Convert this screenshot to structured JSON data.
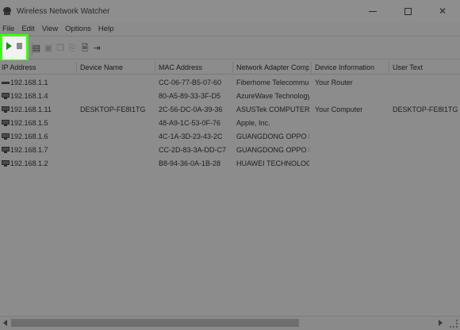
{
  "window": {
    "title": "Wireless Network Watcher",
    "icon": "app-icon"
  },
  "menu": [
    "File",
    "Edit",
    "View",
    "Options",
    "Help"
  ],
  "toolbar": {
    "icons": [
      "play-icon",
      "stop-icon",
      "table-icon",
      "save-icon",
      "copy-icon",
      "export-icon",
      "properties-icon",
      "exit-icon"
    ]
  },
  "table": {
    "columns": [
      "IP Address",
      "Device Name",
      "MAC Address",
      "Network Adapter Comp...",
      "Device Information",
      "User Text"
    ],
    "rows": [
      {
        "ip": "192.168.1.1",
        "name": "",
        "mac": "CC-06-77-B5-07-60",
        "company": "Fiberhome Telecommu...",
        "info": "Your Router",
        "user": ""
      },
      {
        "ip": "192.168.1.4",
        "name": "",
        "mac": "80-A5-89-33-3F-D5",
        "company": "AzureWave Technology ...",
        "info": "",
        "user": ""
      },
      {
        "ip": "192.168.1.11",
        "name": "DESKTOP-FE8I1TG",
        "mac": "2C-56-DC-0A-39-36",
        "company": "ASUSTek COMPUTER INC.",
        "info": "Your Computer",
        "user": "DESKTOP-FE8I1TG"
      },
      {
        "ip": "192.168.1.5",
        "name": "",
        "mac": "48-A9-1C-53-0F-76",
        "company": "Apple, Inc.",
        "info": "",
        "user": ""
      },
      {
        "ip": "192.168.1.6",
        "name": "",
        "mac": "4C-1A-3D-23-43-2C",
        "company": "GUANGDONG OPPO M...",
        "info": "",
        "user": ""
      },
      {
        "ip": "192.168.1.7",
        "name": "",
        "mac": "CC-2D-83-3A-DD-C7",
        "company": "GUANGDONG OPPO M...",
        "info": "",
        "user": ""
      },
      {
        "ip": "192.168.1.2",
        "name": "",
        "mac": "B8-94-36-0A-1B-28",
        "company": "HUAWEI TECHNOLOGIE...",
        "info": "",
        "user": ""
      }
    ]
  },
  "colors": {
    "highlight": "#39ff14",
    "background": "#8c8c8c"
  }
}
